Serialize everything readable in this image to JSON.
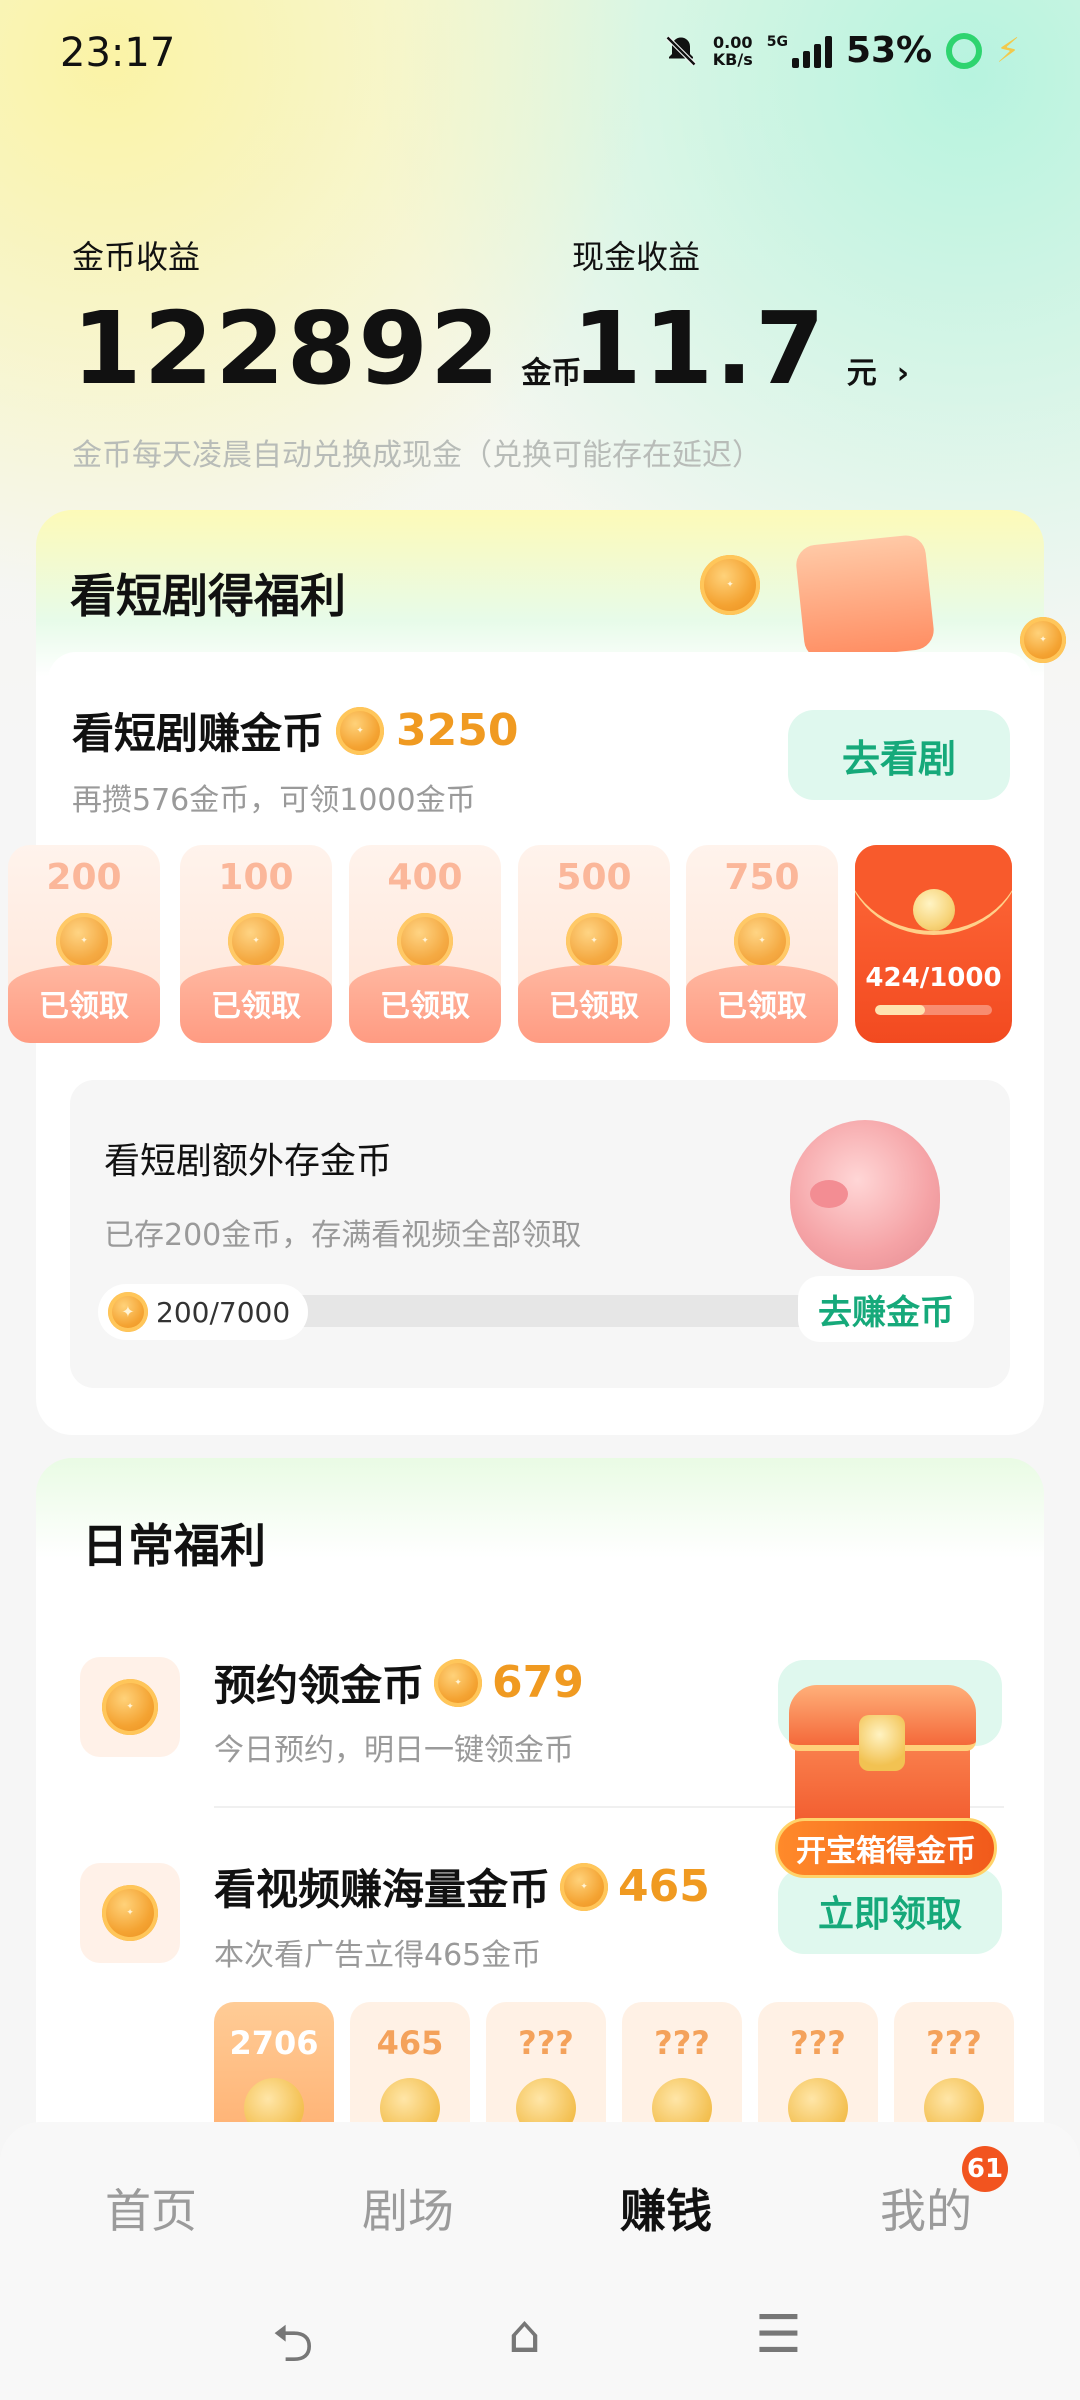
{
  "status_bar": {
    "time": "23:17",
    "net_speed_value": "0.00",
    "net_speed_unit": "KB/s",
    "network": "5G",
    "battery": "53%",
    "icons": [
      "bell-mute-icon",
      "signal-icon",
      "battery-ring-icon",
      "charging-icon"
    ]
  },
  "earnings": {
    "coin_label": "金币收益",
    "coin_value": "122892",
    "coin_unit": "金币",
    "cash_label": "现金收益",
    "cash_value": "11.7",
    "cash_unit": "元",
    "hint": "金币每天凌晨自动兑换成现金（兑换可能存在延迟）"
  },
  "drama_card": {
    "title": "看短剧得福利",
    "task_title": "看短剧赚金币",
    "task_reward": "3250",
    "task_sub": "再攒576金币，可领1000金币",
    "watch_button": "去看剧",
    "tiles": [
      {
        "amount": "200",
        "status": "已领取"
      },
      {
        "amount": "100",
        "status": "已领取"
      },
      {
        "amount": "400",
        "status": "已领取"
      },
      {
        "amount": "500",
        "status": "已领取"
      },
      {
        "amount": "750",
        "status": "已领取"
      }
    ],
    "red_packet_progress": "424/1000",
    "red_packet_fraction": 0.424,
    "save_title": "看短剧额外存金币",
    "save_sub": "已存200金币，存满看视频全部领取",
    "save_progress": "200/7000",
    "save_fraction": 0.0286,
    "earn_button": "去赚金币"
  },
  "daily_card": {
    "title": "日常福利",
    "rows": [
      {
        "title": "预约领金币",
        "reward": "679",
        "sub": "今日预约，明日一键领金币"
      },
      {
        "title": "看视频赚海量金币",
        "reward": "465",
        "sub": "本次看广告立得465金币",
        "button": "立即领取"
      }
    ],
    "chest_label": "开宝箱得金币",
    "reward_tiles": [
      "2706",
      "465",
      "???",
      "???",
      "???",
      "???"
    ]
  },
  "bottom_nav": {
    "items": [
      "首页",
      "剧场",
      "赚钱",
      "我的"
    ],
    "active": "赚钱",
    "badge": "61"
  },
  "colors": {
    "accent_orange": "#f09a21",
    "mint_button": "#dff8ee",
    "mint_text": "#16a97a",
    "red_packet": "#f24a20"
  }
}
